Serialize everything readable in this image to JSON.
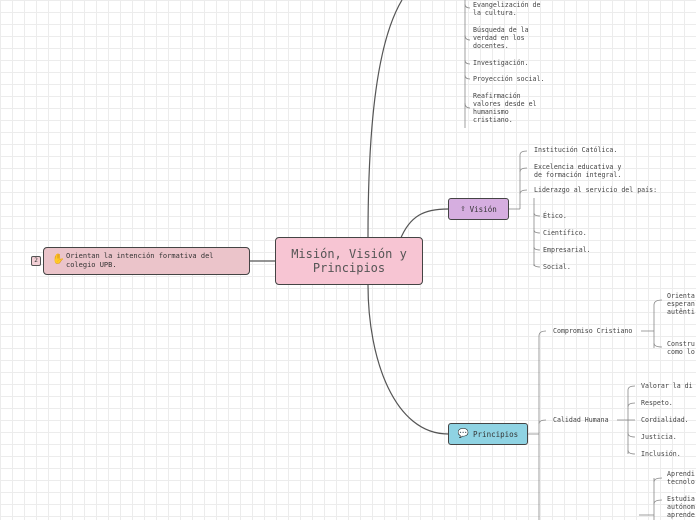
{
  "central": {
    "title": "Misión, Visión y Principios"
  },
  "left": {
    "text": "Orientan la intención formativa del\ncolegio UPB.",
    "badge": "2",
    "icon": "hand-icon"
  },
  "top_items": [
    "Evangelización de\nla cultura.",
    "Búsqueda de la\nverdad en los\ndocentes.",
    "Investigación.",
    "Proyección social.",
    "Reafirmación\nvalores desde el\nhumanismo\ncristiano."
  ],
  "vision": {
    "label": "Visión",
    "icon": "upload-icon",
    "items": [
      "Institución Católica.",
      "Excelencia educativa y\nde formación integral.",
      "Liderazgo al servicio del país:"
    ],
    "sub_items": [
      "Ético.",
      "Científico.",
      "Empresarial.",
      "Social."
    ]
  },
  "principles": {
    "label": "Principios",
    "icon": "chat-icon",
    "compromiso": {
      "label": "Compromiso Cristiano",
      "items": [
        "Orienta\nesperan\nautênti",
        "Constru\ncomo lo"
      ]
    },
    "calidad": {
      "label": "Calidad Humana",
      "items": [
        "Valorar la di",
        "Respeto.",
        "Cordialidad.",
        "Justicia.",
        "Inclusión."
      ]
    },
    "bottom_items": [
      "Aprendi\ntecnolo",
      "Estudia\nautónom\naprende"
    ]
  }
}
